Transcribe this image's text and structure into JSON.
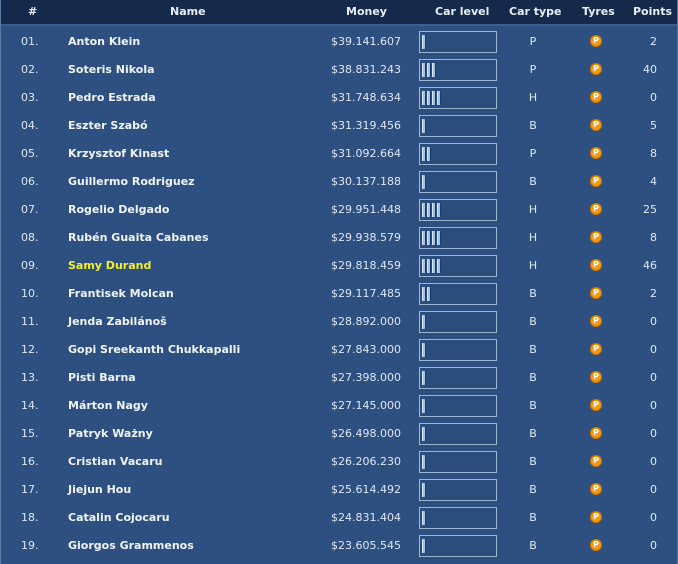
{
  "header": {
    "pos": "#",
    "name": "Name",
    "money": "Money",
    "car_level": "Car level",
    "car_type": "Car type",
    "tyres": "Tyres",
    "points": "Points"
  },
  "tyre_icon_letter": "P",
  "colors": {
    "row_bg": "#2d5080",
    "header_bg": "#152a4a",
    "highlight_name": "#f6f023",
    "tyre_icon": "#f39a10"
  },
  "rows": [
    {
      "pos": "01.",
      "name": "Anton Klein",
      "money": "$39.141.607",
      "car_level": 1,
      "car_type": "P",
      "points": "2",
      "highlight": false
    },
    {
      "pos": "02.",
      "name": "Soteris Nikola",
      "money": "$38.831.243",
      "car_level": 3,
      "car_type": "P",
      "points": "40",
      "highlight": false
    },
    {
      "pos": "03.",
      "name": "Pedro Estrada",
      "money": "$31.748.634",
      "car_level": 4,
      "car_type": "H",
      "points": "0",
      "highlight": false
    },
    {
      "pos": "04.",
      "name": "Eszter Szabó",
      "money": "$31.319.456",
      "car_level": 1,
      "car_type": "B",
      "points": "5",
      "highlight": false
    },
    {
      "pos": "05.",
      "name": "Krzysztof Kinast",
      "money": "$31.092.664",
      "car_level": 2,
      "car_type": "P",
      "points": "8",
      "highlight": false
    },
    {
      "pos": "06.",
      "name": "Guillermo Rodriguez",
      "money": "$30.137.188",
      "car_level": 1,
      "car_type": "B",
      "points": "4",
      "highlight": false
    },
    {
      "pos": "07.",
      "name": "Rogelio Delgado",
      "money": "$29.951.448",
      "car_level": 4,
      "car_type": "H",
      "points": "25",
      "highlight": false
    },
    {
      "pos": "08.",
      "name": "Rubén Guaita Cabanes",
      "money": "$29.938.579",
      "car_level": 4,
      "car_type": "H",
      "points": "8",
      "highlight": false
    },
    {
      "pos": "09.",
      "name": "Samy Durand",
      "money": "$29.818.459",
      "car_level": 4,
      "car_type": "H",
      "points": "46",
      "highlight": true
    },
    {
      "pos": "10.",
      "name": "Frantisek Molcan",
      "money": "$29.117.485",
      "car_level": 2,
      "car_type": "B",
      "points": "2",
      "highlight": false
    },
    {
      "pos": "11.",
      "name": "Jenda Zabilánoš",
      "money": "$28.892.000",
      "car_level": 1,
      "car_type": "B",
      "points": "0",
      "highlight": false
    },
    {
      "pos": "12.",
      "name": "Gopi Sreekanth Chukkapalli",
      "money": "$27.843.000",
      "car_level": 1,
      "car_type": "B",
      "points": "0",
      "highlight": false
    },
    {
      "pos": "13.",
      "name": "Pisti Barna",
      "money": "$27.398.000",
      "car_level": 1,
      "car_type": "B",
      "points": "0",
      "highlight": false
    },
    {
      "pos": "14.",
      "name": "Márton Nagy",
      "money": "$27.145.000",
      "car_level": 1,
      "car_type": "B",
      "points": "0",
      "highlight": false
    },
    {
      "pos": "15.",
      "name": "Patryk Ważny",
      "money": "$26.498.000",
      "car_level": 1,
      "car_type": "B",
      "points": "0",
      "highlight": false
    },
    {
      "pos": "16.",
      "name": "Cristian Vacaru",
      "money": "$26.206.230",
      "car_level": 1,
      "car_type": "B",
      "points": "0",
      "highlight": false
    },
    {
      "pos": "17.",
      "name": "Jiejun Hou",
      "money": "$25.614.492",
      "car_level": 1,
      "car_type": "B",
      "points": "0",
      "highlight": false
    },
    {
      "pos": "18.",
      "name": "Catalin Cojocaru",
      "money": "$24.831.404",
      "car_level": 1,
      "car_type": "B",
      "points": "0",
      "highlight": false
    },
    {
      "pos": "19.",
      "name": "Giorgos Grammenos",
      "money": "$23.605.545",
      "car_level": 1,
      "car_type": "B",
      "points": "0",
      "highlight": false
    }
  ]
}
